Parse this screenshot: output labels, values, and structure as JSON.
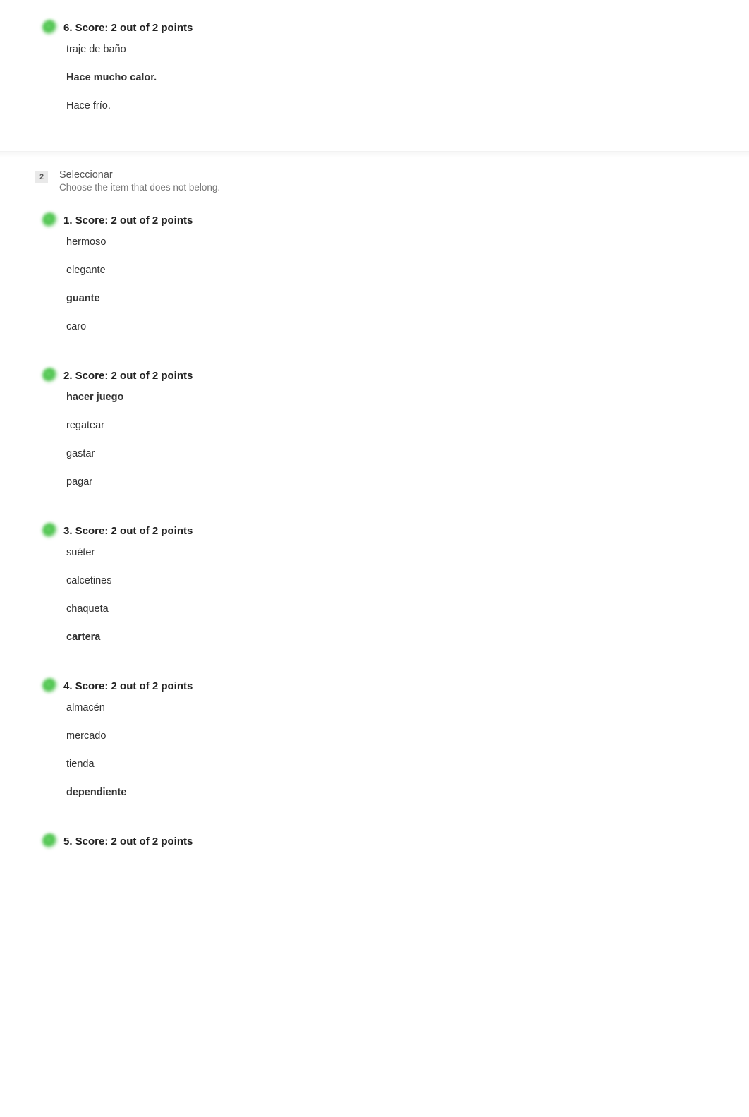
{
  "top_question": {
    "score_label": "6. Score: 2 out of 2 points",
    "options": [
      {
        "text": "traje de baño",
        "correct": false
      },
      {
        "text": "Hace mucho calor.",
        "correct": true
      },
      {
        "text": "Hace frío.",
        "correct": false
      }
    ]
  },
  "section": {
    "number": "2",
    "title": "Seleccionar",
    "subtitle": "Choose the item that does not belong."
  },
  "questions": [
    {
      "score_label": "1. Score: 2 out of 2 points",
      "options": [
        {
          "text": "hermoso",
          "correct": false
        },
        {
          "text": "elegante",
          "correct": false
        },
        {
          "text": "guante",
          "correct": true
        },
        {
          "text": "caro",
          "correct": false
        }
      ]
    },
    {
      "score_label": "2. Score: 2 out of 2 points",
      "options": [
        {
          "text": "hacer juego",
          "correct": true
        },
        {
          "text": "regatear",
          "correct": false
        },
        {
          "text": "gastar",
          "correct": false
        },
        {
          "text": "pagar",
          "correct": false
        }
      ]
    },
    {
      "score_label": "3. Score: 2 out of 2 points",
      "options": [
        {
          "text": "suéter",
          "correct": false
        },
        {
          "text": "calcetines",
          "correct": false
        },
        {
          "text": "chaqueta",
          "correct": false
        },
        {
          "text": "cartera",
          "correct": true
        }
      ]
    },
    {
      "score_label": "4. Score: 2 out of 2 points",
      "options": [
        {
          "text": "almacén",
          "correct": false
        },
        {
          "text": "mercado",
          "correct": false
        },
        {
          "text": "tienda",
          "correct": false
        },
        {
          "text": "dependiente",
          "correct": true
        }
      ]
    },
    {
      "score_label": "5. Score: 2 out of 2 points",
      "options": []
    }
  ]
}
